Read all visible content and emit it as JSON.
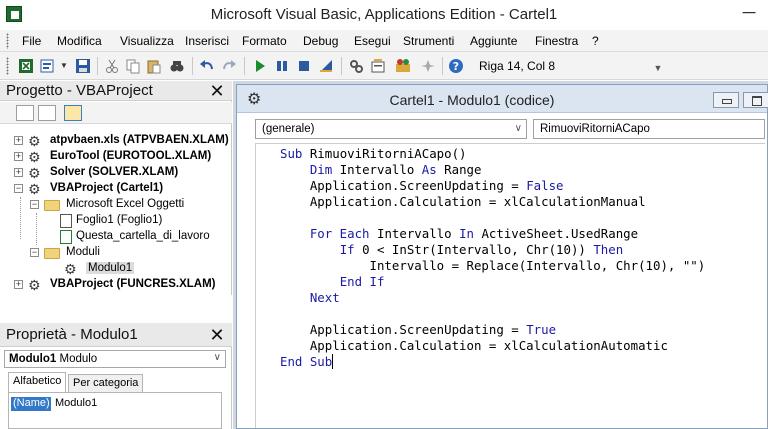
{
  "window": {
    "title": "Microsoft Visual Basic, Applications Edition - Cartel1",
    "min_glyph": "─"
  },
  "menu": {
    "items": [
      "File",
      "Modifica",
      "Visualizza",
      "Inserisci",
      "Formato",
      "Debug",
      "Esegui",
      "Strumenti",
      "Aggiunte",
      "Finestra",
      "?"
    ]
  },
  "toolbar": {
    "cursor_position": "Riga 14, Col 8"
  },
  "project_panel": {
    "title": "Progetto - VBAProject",
    "close_glyph": "✕",
    "tree": [
      {
        "label": "atpvbaen.xls (ATPVBAEN.XLAM)",
        "bold": true,
        "expander": "+"
      },
      {
        "label": "EuroTool (EUROTOOL.XLAM)",
        "bold": true,
        "expander": "+"
      },
      {
        "label": "Solver (SOLVER.XLAM)",
        "bold": true,
        "expander": "+"
      },
      {
        "label": "VBAProject (Cartel1)",
        "bold": true,
        "expander": "−"
      },
      {
        "label": "Microsoft Excel Oggetti",
        "bold": false,
        "expander": "−"
      },
      {
        "label": "Foglio1 (Foglio1)",
        "bold": false,
        "expander": ""
      },
      {
        "label": "Questa_cartella_di_lavoro",
        "bold": false,
        "expander": ""
      },
      {
        "label": "Moduli",
        "bold": false,
        "expander": "−"
      },
      {
        "label": "Modulo1",
        "bold": false,
        "expander": ""
      },
      {
        "label": "VBAProject (FUNCRES.XLAM)",
        "bold": true,
        "expander": "+"
      }
    ]
  },
  "properties_panel": {
    "title": "Proprietà - Modulo1",
    "close_glyph": "✕",
    "object_name": "Modulo1",
    "object_type": "Modulo",
    "tabs": [
      "Alfabetico",
      "Per categoria"
    ],
    "property_name": "(Name)",
    "property_value": "Modulo1"
  },
  "code_window": {
    "title": "Cartel1 - Modulo1 (codice)",
    "object_combo": "(generale)",
    "procedure_combo": "RimuoviRitorniACapo",
    "lines": [
      [
        {
          "k": 1,
          "t": "Sub"
        },
        {
          "k": 0,
          "t": " RimuoviRitorniACapo()"
        }
      ],
      [
        {
          "k": 0,
          "t": "    "
        },
        {
          "k": 1,
          "t": "Dim"
        },
        {
          "k": 0,
          "t": " Intervallo "
        },
        {
          "k": 1,
          "t": "As"
        },
        {
          "k": 0,
          "t": " Range"
        }
      ],
      [
        {
          "k": 0,
          "t": "    Application.ScreenUpdating = "
        },
        {
          "k": 1,
          "t": "False"
        }
      ],
      [
        {
          "k": 0,
          "t": "    Application.Calculation = xlCalculationManual"
        }
      ],
      [
        {
          "k": 0,
          "t": ""
        }
      ],
      [
        {
          "k": 0,
          "t": "    "
        },
        {
          "k": 1,
          "t": "For Each"
        },
        {
          "k": 0,
          "t": " Intervallo "
        },
        {
          "k": 1,
          "t": "In"
        },
        {
          "k": 0,
          "t": " ActiveSheet.UsedRange"
        }
      ],
      [
        {
          "k": 0,
          "t": "        "
        },
        {
          "k": 1,
          "t": "If"
        },
        {
          "k": 0,
          "t": " 0 < InStr(Intervallo, Chr(10)) "
        },
        {
          "k": 1,
          "t": "Then"
        }
      ],
      [
        {
          "k": 0,
          "t": "            Intervallo = Replace(Intervallo, Chr(10), \"\")"
        }
      ],
      [
        {
          "k": 0,
          "t": "        "
        },
        {
          "k": 1,
          "t": "End If"
        }
      ],
      [
        {
          "k": 0,
          "t": "    "
        },
        {
          "k": 1,
          "t": "Next"
        }
      ],
      [
        {
          "k": 0,
          "t": ""
        }
      ],
      [
        {
          "k": 0,
          "t": "    Application.ScreenUpdating = "
        },
        {
          "k": 1,
          "t": "True"
        }
      ],
      [
        {
          "k": 0,
          "t": "    Application.Calculation = xlCalculationAutomatic"
        }
      ],
      [
        {
          "k": 1,
          "t": "End Sub"
        }
      ]
    ]
  },
  "colors": {
    "keyword": "#1a1aa6",
    "selection": "#3478c8"
  }
}
